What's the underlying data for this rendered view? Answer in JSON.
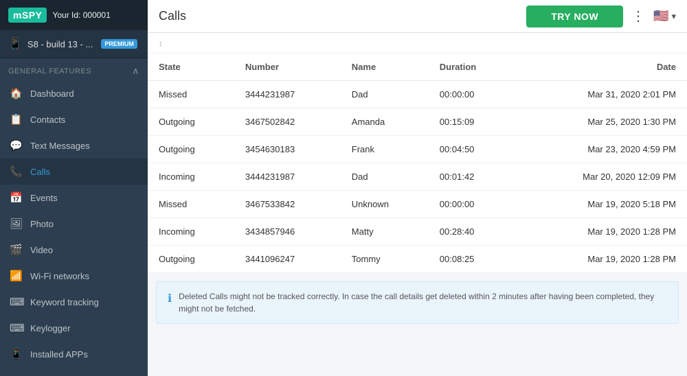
{
  "sidebar": {
    "logo": "mSPY",
    "user_id_label": "Your Id: 000001",
    "device": {
      "name": "S8 - build 13 - ...",
      "badge": "PREMIUM"
    },
    "section_label": "GENERAL FEATURES",
    "nav_items": [
      {
        "id": "dashboard",
        "label": "Dashboard",
        "icon": "🏠"
      },
      {
        "id": "contacts",
        "label": "Contacts",
        "icon": "📋"
      },
      {
        "id": "text-messages",
        "label": "Text Messages",
        "icon": "💬"
      },
      {
        "id": "calls",
        "label": "Calls",
        "icon": "📞",
        "active": true
      },
      {
        "id": "events",
        "label": "Events",
        "icon": "📅"
      },
      {
        "id": "photo",
        "label": "Photo",
        "icon": "🖼"
      },
      {
        "id": "video",
        "label": "Video",
        "icon": "🎬"
      },
      {
        "id": "wifi",
        "label": "Wi-Fi networks",
        "icon": "📶"
      },
      {
        "id": "keyword-tracking",
        "label": "Keyword tracking",
        "icon": "⌨"
      },
      {
        "id": "keylogger",
        "label": "Keylogger",
        "icon": "⌨"
      },
      {
        "id": "installed-apps",
        "label": "Installed APPs",
        "icon": "📱"
      }
    ]
  },
  "topbar": {
    "title": "Calls",
    "try_now_label": "TRY NOW",
    "dots": "⋮",
    "flag": "🇺🇸"
  },
  "table": {
    "columns": [
      "State",
      "Number",
      "Name",
      "Duration",
      "Date"
    ],
    "rows": [
      {
        "state": "Missed",
        "number": "3444231987",
        "name": "Dad",
        "duration": "00:00:00",
        "date": "Mar 31, 2020 2:01 PM"
      },
      {
        "state": "Outgoing",
        "number": "3467502842",
        "name": "Amanda",
        "duration": "00:15:09",
        "date": "Mar 25, 2020 1:30 PM"
      },
      {
        "state": "Outgoing",
        "number": "3454630183",
        "name": "Frank",
        "duration": "00:04:50",
        "date": "Mar 23, 2020 4:59 PM"
      },
      {
        "state": "Incoming",
        "number": "3444231987",
        "name": "Dad",
        "duration": "00:01:42",
        "date": "Mar 20, 2020 12:09 PM"
      },
      {
        "state": "Missed",
        "number": "3467533842",
        "name": "Unknown",
        "duration": "00:00:00",
        "date": "Mar 19, 2020 5:18 PM"
      },
      {
        "state": "Incoming",
        "number": "3434857946",
        "name": "Matty",
        "duration": "00:28:40",
        "date": "Mar 19, 2020 1:28 PM"
      },
      {
        "state": "Outgoing",
        "number": "3441096247",
        "name": "Tommy",
        "duration": "00:08:25",
        "date": "Mar 19, 2020 1:28 PM"
      }
    ]
  },
  "info_box": {
    "text": "Deleted Calls might not be tracked correctly. In case the call details get deleted within 2 minutes after having been completed, they might not be fetched."
  }
}
